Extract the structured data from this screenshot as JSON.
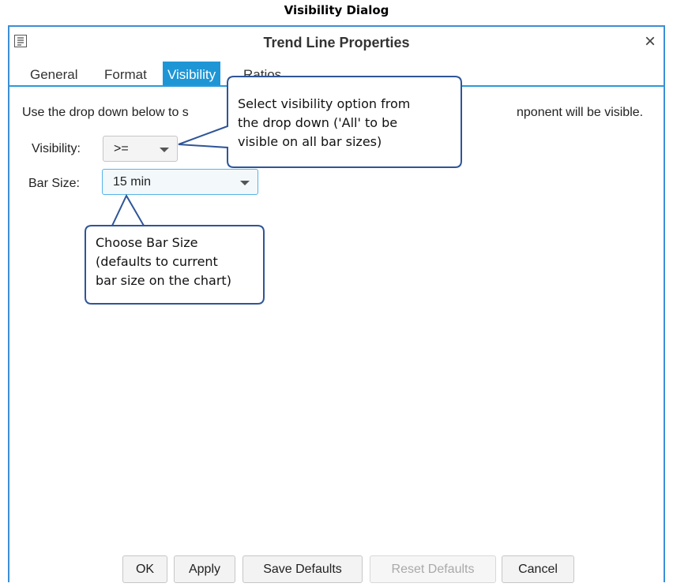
{
  "caption": "Visibility Dialog",
  "dialog": {
    "title": "Trend Line Properties",
    "close_icon": "close-icon",
    "app_icon": "properties-grid-icon"
  },
  "tabs": [
    {
      "label": "General",
      "active": false
    },
    {
      "label": "Format",
      "active": false
    },
    {
      "label": "Visibility",
      "active": true
    },
    {
      "label": "Ratios",
      "active": false
    }
  ],
  "description": {
    "left": "Use the drop down below to s",
    "right": "nponent will be visible."
  },
  "visibility": {
    "label": "Visibility:",
    "value": ">="
  },
  "bar_size": {
    "label": "Bar Size:",
    "value": "15 min"
  },
  "callouts": {
    "visibility": [
      "Select visibility option from",
      "the drop down ('All' to be",
      "visible on all bar sizes)"
    ],
    "bar_size": [
      "Choose Bar Size",
      "(defaults to current",
      "bar size on the chart)"
    ]
  },
  "buttons": {
    "ok": "OK",
    "apply": "Apply",
    "save_defaults": "Save Defaults",
    "reset_defaults": "Reset Defaults",
    "cancel": "Cancel"
  },
  "colors": {
    "accent": "#1e96d6",
    "dialog_border": "#3b8fd5",
    "callout_border": "#2f5597"
  }
}
